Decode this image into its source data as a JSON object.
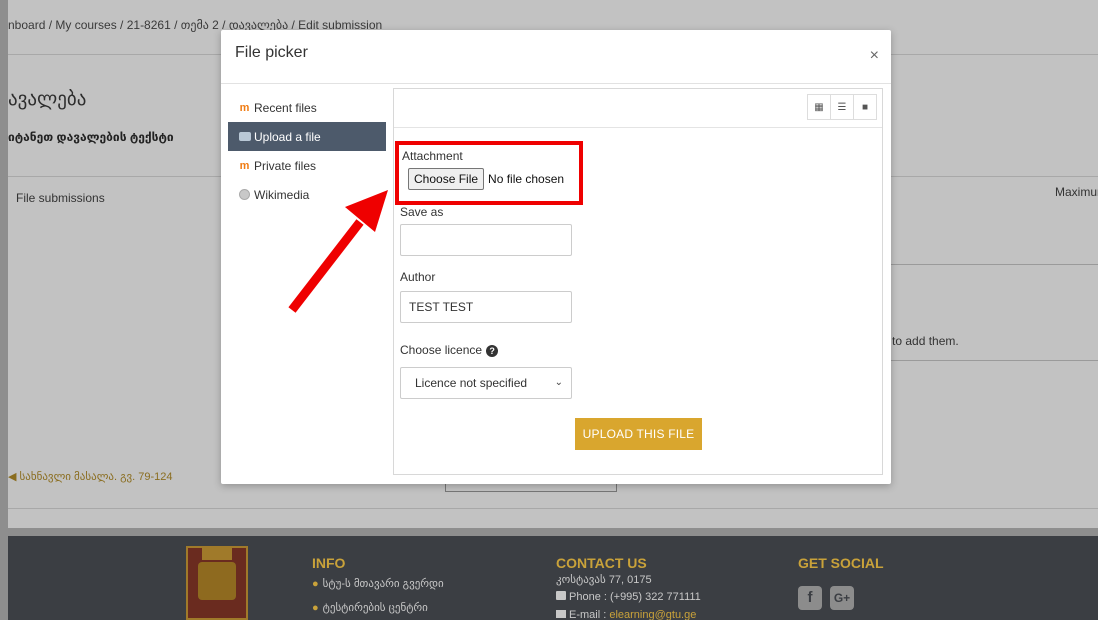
{
  "breadcrumb": "nboard  /  My courses  /  21-8261  /  თემა 2  /  დავალება  /  Edit submission",
  "background": {
    "title": "ავალება",
    "subtitle": "იტანეთ დავალების ტექსტი",
    "file_submissions": "File submissions",
    "maximum": "Maximum",
    "add_them": "to add them.",
    "prev_link": "◀ სახნავლი მასალა. გვ. 79-124"
  },
  "modal": {
    "title": "File picker",
    "close": "×",
    "nav": [
      {
        "label": "Recent files",
        "icon": "moodle-icon"
      },
      {
        "label": "Upload a file",
        "icon": "upload-icon"
      },
      {
        "label": "Private files",
        "icon": "moodle-icon"
      },
      {
        "label": "Wikimedia",
        "icon": "globe-icon"
      }
    ],
    "view_icons": [
      "grid-view-icon",
      "list-view-icon",
      "folder-view-icon"
    ],
    "attachment_label": "Attachment",
    "choose_file": "Choose File",
    "no_file": "No file chosen",
    "save_as_label": "Save as",
    "save_as_value": "",
    "author_label": "Author",
    "author_value": "TEST TEST",
    "licence_label": "Choose licence",
    "licence_value": "Licence not specified",
    "upload_button": "UPLOAD THIS FILE"
  },
  "footer": {
    "info_heading": "INFO",
    "info_items": [
      "სტუ-ს მთავარი გვერდი",
      "ტესტირების ცენტრი"
    ],
    "contact_heading": "CONTACT US",
    "address": "კოსტავას 77, 0175",
    "phone": "Phone : (+995) 322 771111",
    "email_label": "E-mail : ",
    "email": "elearning@gtu.ge",
    "social_heading": "GET SOCIAL",
    "social": [
      "f",
      "G+"
    ]
  },
  "colors": {
    "accent": "#d9a62e",
    "highlight": "#ef0000",
    "nav_active": "#4d5a6b"
  }
}
